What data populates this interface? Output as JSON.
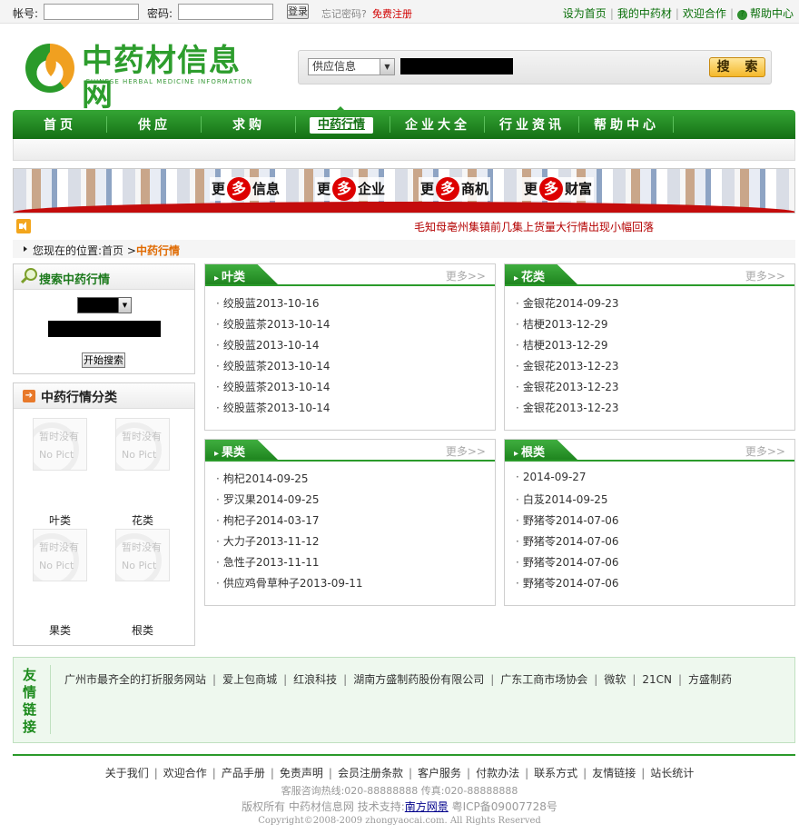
{
  "topbar": {
    "account_label": "帐号:",
    "password_label": "密码:",
    "login_button": "登录",
    "forgot": "忘记密码?",
    "register": "免费注册",
    "links": [
      "设为首页",
      "我的中药材",
      "欢迎合作",
      "帮助中心"
    ]
  },
  "logo": {
    "cn": "中药材信息网",
    "en": "CHINESE HERBAL MEDICINE INFORMATION"
  },
  "search": {
    "category": "供应信息",
    "button": "搜 索"
  },
  "nav": {
    "items": [
      "首页",
      "供应",
      "求购",
      "中药行情",
      "企业大全",
      "行业资讯",
      "帮助中心"
    ],
    "active_index": 3
  },
  "banner": {
    "slogans": [
      {
        "pre": "更",
        "mid": "多",
        "post": "信息"
      },
      {
        "pre": "更",
        "mid": "多",
        "post": "企业"
      },
      {
        "pre": "更",
        "mid": "多",
        "post": "商机"
      },
      {
        "pre": "更",
        "mid": "多",
        "post": "财富"
      }
    ]
  },
  "ticker": "毛知母亳州集镇前几集上货量大行情出现小幅回落",
  "breadcrumb": {
    "prefix": "您现在的位置:",
    "home": "首页",
    "arrow": ">",
    "current": "中药行情"
  },
  "left_search": {
    "title": "搜索中药行情",
    "button": "开始搜索"
  },
  "categories_panel": {
    "title": "中药行情分类",
    "placeholder_line1": "暂时没有",
    "placeholder_line2": "No Pict",
    "items": [
      "叶类",
      "花类",
      "果类",
      "根类"
    ]
  },
  "boxes": [
    {
      "title": "叶类",
      "more": "更多>>",
      "items": [
        "绞股蓝2013-10-16",
        "绞股蓝茶2013-10-14",
        "绞股蓝2013-10-14",
        "绞股蓝茶2013-10-14",
        "绞股蓝茶2013-10-14",
        "绞股蓝茶2013-10-14"
      ]
    },
    {
      "title": "花类",
      "more": "更多>>",
      "items": [
        "金银花2014-09-23",
        "桔梗2013-12-29",
        "桔梗2013-12-29",
        "金银花2013-12-23",
        "金银花2013-12-23",
        "金银花2013-12-23"
      ]
    },
    {
      "title": "果类",
      "more": "更多>>",
      "items": [
        "枸杞2014-09-25",
        "罗汉果2014-09-25",
        "枸杞子2014-03-17",
        "大力子2013-11-12",
        "急性子2013-11-11",
        "供应鸡骨草种子2013-09-11"
      ]
    },
    {
      "title": "根类",
      "more": "更多>>",
      "items": [
        "2014-09-27",
        "白芨2014-09-25",
        "野猪苓2014-07-06",
        "野猪苓2014-07-06",
        "野猪苓2014-07-06",
        "野猪苓2014-07-06"
      ]
    }
  ],
  "friends": {
    "title": "友情链接",
    "links": [
      "广州市最齐全的打折服务网站",
      "爱上包商城",
      "红浪科技",
      "湖南方盛制药股份有限公司",
      "广东工商市场协会",
      "微软",
      "21CN",
      "方盛制药"
    ]
  },
  "footer": {
    "links": [
      "关于我们",
      "欢迎合作",
      "产品手册",
      "免责声明",
      "会员注册条款",
      "客户服务",
      "付款办法",
      "联系方式",
      "友情链接",
      "站长统计"
    ],
    "hotline": "客服咨询热线:020-88888888 传真:020-88888888",
    "copyright_prefix": "版权所有 中药材信息网 技术支持:",
    "tech_support": "南方网景",
    "icp": "粤ICP备09007728号",
    "copyright_en": "Copyright©2008-2009 zhongyaocai.com. All Rights Reserved"
  }
}
